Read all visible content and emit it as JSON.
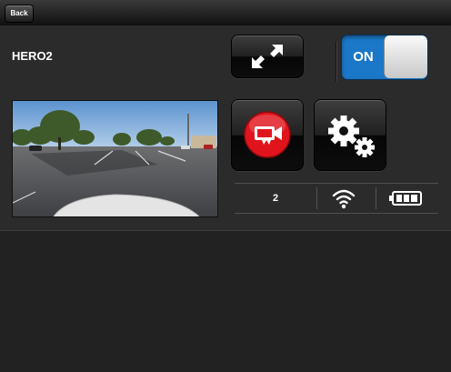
{
  "header": {
    "back_label": "Back"
  },
  "camera": {
    "name": "HERO2"
  },
  "power_toggle": {
    "label": "ON",
    "state": "on",
    "color": "#1b78c8"
  },
  "controls": {
    "fullscreen_icon": "expand-arrows-icon",
    "record_icon": "video-camera-icon",
    "settings_icon": "gears-icon",
    "record_color": "#e0141c"
  },
  "preview": {
    "description_icon": "live-preview-image"
  },
  "status": {
    "count": "2",
    "wifi_icon": "wifi-icon",
    "battery_icon": "battery-icon",
    "battery_level": 1.0
  }
}
